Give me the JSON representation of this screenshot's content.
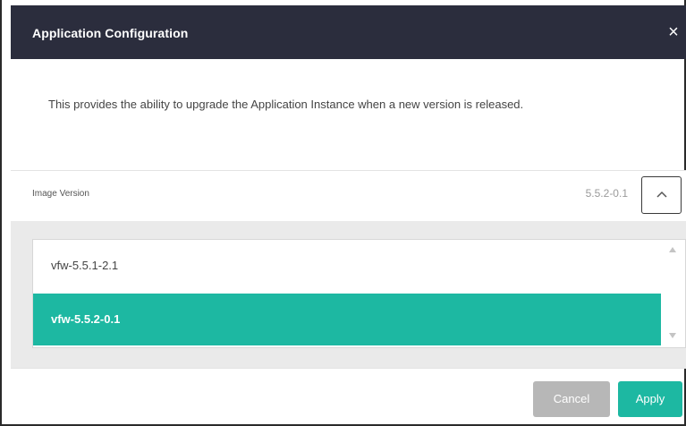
{
  "dialog": {
    "title": "Application Configuration",
    "close_icon": "×"
  },
  "description": "This provides the ability to upgrade the Application Instance when a new version is released.",
  "image_version": {
    "label": "Image Version",
    "value": "5.5.2-0.1"
  },
  "dropdown": {
    "options": [
      {
        "label": "vfw-5.5.1-2.1",
        "selected": false
      },
      {
        "label": "vfw-5.5.2-0.1",
        "selected": true
      }
    ]
  },
  "footer": {
    "cancel_label": "Cancel",
    "apply_label": "Apply"
  },
  "colors": {
    "header_bg": "#2b2d3d",
    "accent": "#1db8a2",
    "cancel_bg": "#b7b7b7"
  },
  "icons": {
    "close": "close-icon",
    "toggle": "chevron-up-icon",
    "scroll_up": "scroll-up-arrow-icon",
    "scroll_down": "scroll-down-arrow-icon"
  }
}
